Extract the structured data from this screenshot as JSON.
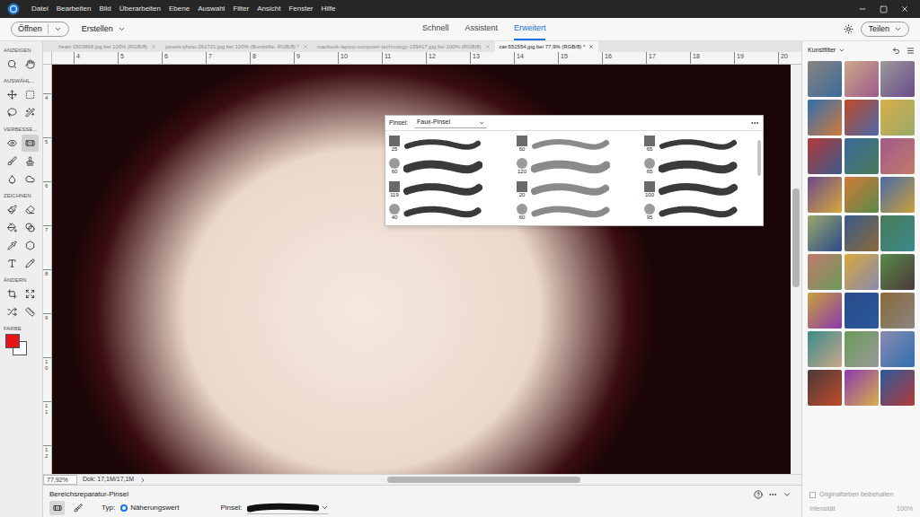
{
  "menu": [
    "Datei",
    "Bearbeiten",
    "Bild",
    "Überarbeiten",
    "Ebene",
    "Auswahl",
    "Filter",
    "Ansicht",
    "Fenster",
    "Hilfe"
  ],
  "toolbar": {
    "open": "Öffnen",
    "create": "Erstellen",
    "modes": [
      {
        "label": "Schnell",
        "selected": false
      },
      {
        "label": "Assistent",
        "selected": false
      },
      {
        "label": "Erweitert",
        "selected": true
      }
    ],
    "share": "Teilen"
  },
  "documents": [
    {
      "label": "heart-1503868.jpg bei 100% (RGB/8)",
      "selected": false
    },
    {
      "label": "pexels-photo-261721.jpg bei 100% (Buntstifte, RGB/8) *",
      "selected": false
    },
    {
      "label": "macbook-laptop-computer-technology-159417.jpg bei 100% (RGB/8)",
      "selected": false
    },
    {
      "label": "cat-551554.jpg bei 77,9% (RGB/8) *",
      "selected": true
    }
  ],
  "tools": {
    "sections": [
      {
        "label": "ANZEIGEN",
        "tools": [
          {
            "selected": false
          },
          {
            "selected": false
          }
        ]
      },
      {
        "label": "AUSWÄHL...",
        "tools": [
          {
            "selected": false
          },
          {
            "selected": false
          },
          {
            "selected": false
          },
          {
            "selected": false
          }
        ]
      },
      {
        "label": "VERBESSE...",
        "tools": [
          {
            "selected": false
          },
          {
            "selected": true
          },
          {
            "selected": false
          },
          {
            "selected": false
          },
          {
            "selected": false
          },
          {
            "selected": false
          }
        ]
      },
      {
        "label": "ZEICHNEN",
        "tools": [
          {
            "selected": false
          },
          {
            "selected": false
          },
          {
            "selected": false
          },
          {
            "selected": false
          },
          {
            "selected": false
          },
          {
            "selected": false
          },
          {
            "selected": false
          },
          {
            "selected": false
          }
        ]
      },
      {
        "label": "ÄNDERN",
        "tools": [
          {
            "selected": false
          },
          {
            "selected": false
          },
          {
            "selected": false
          },
          {
            "selected": false
          }
        ]
      }
    ],
    "color": {
      "label": "FARBE",
      "foreground": "#e8141c",
      "background": "#ffffff"
    }
  },
  "rulers": {
    "top": [
      "4",
      "5",
      "6",
      "7",
      "8",
      "9",
      "10",
      "11",
      "12",
      "13",
      "14",
      "15",
      "16",
      "17",
      "18",
      "19",
      "20"
    ],
    "left": [
      "4",
      "5",
      "6",
      "7",
      "8",
      "9",
      "10",
      "11",
      "12"
    ]
  },
  "status": {
    "zoom": "77,92%",
    "doc": "Dok: 17,1M/17,1M"
  },
  "brush_picker": {
    "label": "Pinsel:",
    "set": "Faux-Pinsel",
    "brushes": [
      {
        "size": "25"
      },
      {
        "size": "60"
      },
      {
        "size": "119"
      },
      {
        "size": "40"
      },
      {
        "size": "60"
      },
      {
        "size": "120"
      },
      {
        "size": "20"
      },
      {
        "size": "60"
      },
      {
        "size": "65"
      },
      {
        "size": "65"
      },
      {
        "size": "100"
      },
      {
        "size": "95"
      }
    ]
  },
  "art_filters": {
    "title": "Kunstfilter",
    "keep_colors": {
      "label": "Originalfarben beibehalten",
      "checked": false,
      "disabled": true
    },
    "intensity": {
      "label": "Intensität",
      "value": "100%",
      "disabled": true
    }
  },
  "tool_options": {
    "title": "Bereichsreparatur-Pinsel",
    "modes": [
      {
        "selected": true
      },
      {
        "selected": false
      }
    ],
    "type_label": "Typ:",
    "type_options": [
      {
        "label": "Näherungswert",
        "selected": true
      }
    ],
    "brush_label": "Pinsel:"
  }
}
